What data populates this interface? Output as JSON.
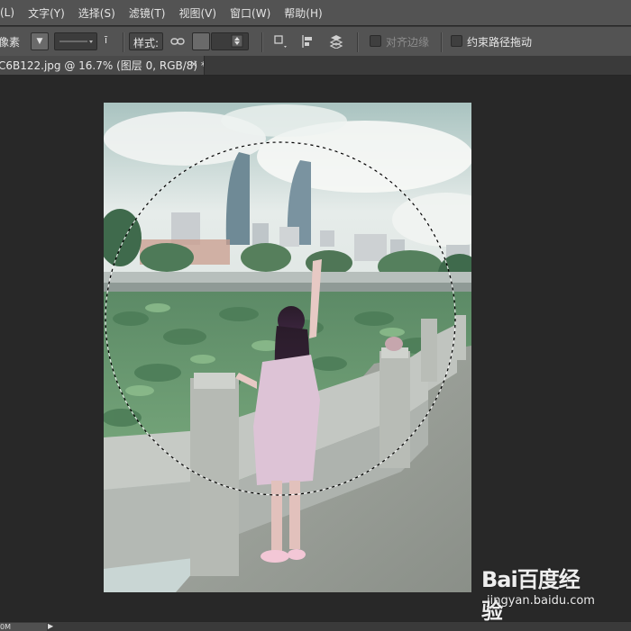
{
  "menubar": {
    "items": [
      "(L)",
      "文字(Y)",
      "选择(S)",
      "滤镜(T)",
      "视图(V)",
      "窗口(W)",
      "帮助(H)"
    ]
  },
  "options": {
    "mode_label": "像素",
    "style_label": "样式:",
    "align_edges_label": "对齐边缘",
    "constrain_path_label": "约束路径拖动",
    "align_edges_checked": false,
    "constrain_path_checked": false
  },
  "document": {
    "tab_title": "C6B122.jpg @ 16.7% (图层 0, RGB/8) *",
    "close_glyph": "×"
  },
  "status": {
    "zoom": "0M"
  },
  "watermark": {
    "logo": "Bai百度经验",
    "domain": "jingyan.baidu.com"
  },
  "colors": {
    "ui_panel": "#535353",
    "workspace": "#282828"
  }
}
